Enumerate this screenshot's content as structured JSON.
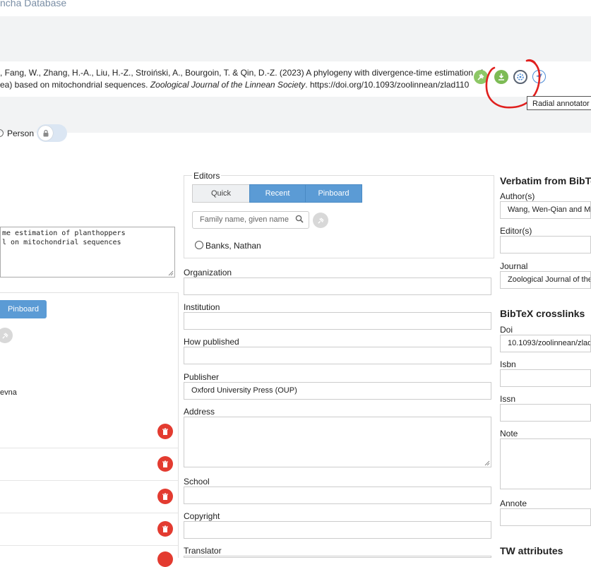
{
  "app": {
    "title": "ncha Database"
  },
  "citation": {
    "line1": ", Fang, W., Zhang, H.-A., Liu, H.-Z., Stroiński, A., Bourgoin, T. & Qin, D.-Z. (2023) A phylogeny with divergence-time estimation of",
    "line2_prefix": "ea) based on mitochondrial sequences. ",
    "journal": "Zoological Journal of the Linnean Society",
    "line2_suffix": ". https://doi.org/10.1093/zoolinnean/zlad110"
  },
  "tooltip": "Radial annotator",
  "person": {
    "label": "Person"
  },
  "title_text": "me estimation of planthoppers\nl on mitochondrial sequences",
  "left_panel": {
    "pinboard_label": "Pinboard",
    "name_fragment": "evna"
  },
  "editors": {
    "legend": "Editors",
    "tabs": [
      "Quick",
      "Recent",
      "Pinboard"
    ],
    "search_placeholder": "Family name, given name",
    "option": "Banks, Nathan"
  },
  "fields": {
    "organization": {
      "label": "Organization",
      "value": ""
    },
    "institution": {
      "label": "Institution",
      "value": ""
    },
    "how_published": {
      "label": "How published",
      "value": ""
    },
    "publisher": {
      "label": "Publisher",
      "value": "Oxford University Press (OUP)"
    },
    "address": {
      "label": "Address",
      "value": ""
    },
    "school": {
      "label": "School",
      "value": ""
    },
    "copyright": {
      "label": "Copyright",
      "value": ""
    },
    "translator": {
      "label": "Translator",
      "value": ""
    }
  },
  "verbatim": {
    "heading": "Verbatim from BibTeX",
    "authors_label": "Author(s)",
    "authors_value": "Wang, Wen-Qian and Me",
    "editors_label": "Editor(s)",
    "journal_label": "Journal",
    "journal_value": "Zoological Journal of the"
  },
  "crosslinks": {
    "heading": "BibTeX crosslinks",
    "doi_label": "Doi",
    "doi_value": "10.1093/zoolinnean/zlad",
    "isbn_label": "Isbn",
    "issn_label": "Issn",
    "note_label": "Note",
    "annote_label": "Annote"
  },
  "tw_attributes": {
    "heading": "TW attributes"
  },
  "colors": {
    "accent": "#5b9bd5",
    "green": "#8dc766",
    "danger": "#e33b30",
    "annotation_red": "#e0201e"
  }
}
